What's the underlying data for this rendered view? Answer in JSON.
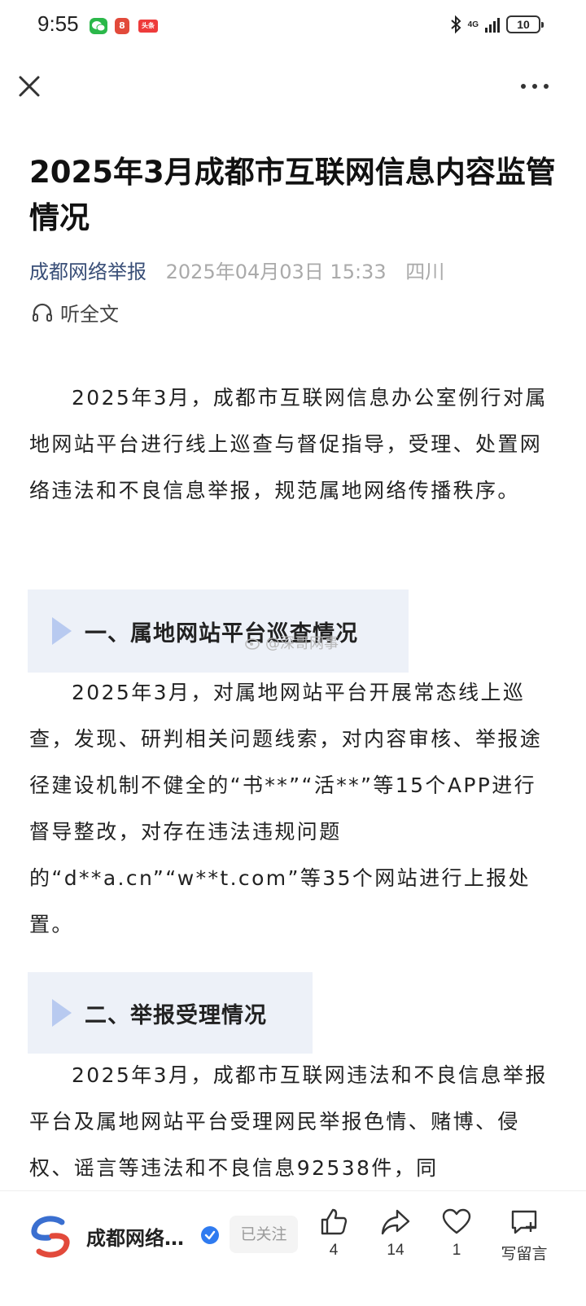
{
  "status_bar": {
    "time": "9:55",
    "notif_app_glyph": "8",
    "notif_toutiao_label": "头条",
    "network": "4G",
    "battery": "10"
  },
  "nav": {
    "close_icon": "close-icon",
    "more_icon": "more-icon"
  },
  "article": {
    "title": "2025年3月成都市互联网信息内容监管情况",
    "source": "成都网络举报",
    "date": "2025年04月03日 15:33",
    "location": "四川",
    "listen_label": "听全文",
    "intro": "2025年3月，成都市互联网信息办公室例行对属地网站平台进行线上巡查与督促指导，受理、处置网络违法和不良信息举报，规范属地网络传播秩序。",
    "section1_title": "一、属地网站平台巡查情况",
    "section1_body": "2025年3月，对属地网站平台开展常态线上巡查，发现、研判相关问题线索，对内容审核、举报途径建设机制不健全的“书**”“活**”等15个APP进行督导整改，对存在违法违规问题的“d**a.cn”“w**t.com”等35个网站进行上报处置。",
    "section2_title": "二、举报受理情况",
    "section2_body": "2025年3月，成都市互联网违法和不良信息举报平台及属地网站平台受理网民举报色情、赌博、侵权、谣言等违法和不良信息92538件，同"
  },
  "watermark": "@深哥网事",
  "bottom_bar": {
    "account_name": "成都网络…",
    "follow_label": "已关注",
    "like_count": "4",
    "share_count": "14",
    "favorite_count": "1",
    "comment_label": "写留言"
  },
  "colors": {
    "accent_link": "#3a4f78",
    "section_bg": "#edf1f8",
    "section_arrow": "#b8caf0",
    "verified_blue": "#2f7bf0"
  }
}
